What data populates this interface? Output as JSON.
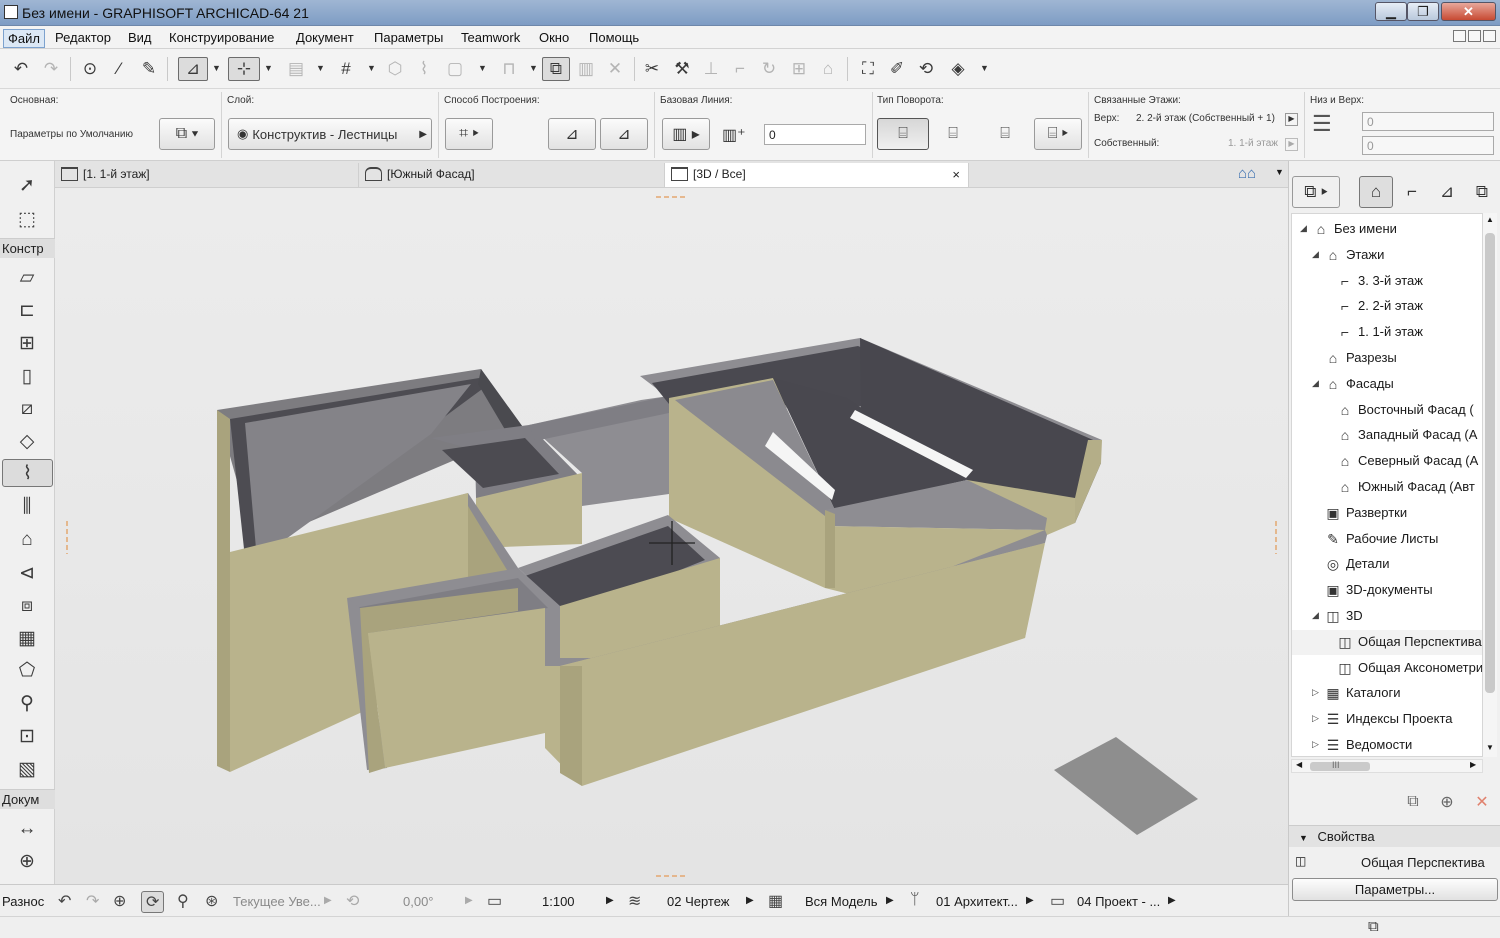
{
  "window": {
    "title": "Без имени - GRAPHISOFT ARCHICAD-64 21",
    "minimize": "▁",
    "restore": "❐",
    "close": "✕"
  },
  "menu": {
    "items": [
      "Файл",
      "Редактор",
      "Вид",
      "Конструирование",
      "Документ",
      "Параметры",
      "Teamwork",
      "Окно",
      "Помощь"
    ]
  },
  "infobox": {
    "main_label": "Основная:",
    "default_params": "Параметры по Умолчанию",
    "layer_label": "Слой:",
    "layer_value": "Конструктив - Лестницы",
    "method_label": "Способ Построения:",
    "baseline_label": "Базовая Линия:",
    "baseline_value": "0",
    "turn_label": "Тип Поворота:",
    "linked_label": "Связанные Этажи:",
    "top_label": "Верх:",
    "top_value": "2. 2-й этаж (Собственный + 1)",
    "own_label": "Собственный:",
    "own_value": "1. 1-й этаж",
    "bottom_top_label": "Низ и Верх:",
    "bottom_value": "0",
    "top_offset_value": "0"
  },
  "tabs": [
    {
      "label": "[1. 1-й этаж]"
    },
    {
      "label": "[Южный Фасад]"
    },
    {
      "label": "[3D / Все]",
      "close": "×"
    }
  ],
  "toolbox": {
    "groups": [
      "Констр",
      "Докум",
      "Разнос"
    ]
  },
  "navigator": {
    "items": [
      {
        "label": "Без имени",
        "twisty": "◢",
        "icon": "⌂"
      },
      {
        "label": "Этажи",
        "twisty": "◢",
        "icon": "⌂"
      },
      {
        "label": "3. 3-й этаж",
        "twisty": "",
        "icon": "⌐"
      },
      {
        "label": "2. 2-й этаж",
        "twisty": "",
        "icon": "⌐"
      },
      {
        "label": "1. 1-й этаж",
        "twisty": "",
        "icon": "⌐"
      },
      {
        "label": "Разрезы",
        "twisty": "",
        "icon": "⌂"
      },
      {
        "label": "Фасады",
        "twisty": "◢",
        "icon": "⌂"
      },
      {
        "label": "Восточный Фасад (",
        "twisty": "",
        "icon": "⌂"
      },
      {
        "label": "Западный Фасад (А",
        "twisty": "",
        "icon": "⌂"
      },
      {
        "label": "Северный Фасад (А",
        "twisty": "",
        "icon": "⌂"
      },
      {
        "label": "Южный Фасад (Авт",
        "twisty": "",
        "icon": "⌂"
      },
      {
        "label": "Развертки",
        "twisty": "",
        "icon": "▣"
      },
      {
        "label": "Рабочие Листы",
        "twisty": "",
        "icon": "✎"
      },
      {
        "label": "Детали",
        "twisty": "",
        "icon": "◎"
      },
      {
        "label": "3D-документы",
        "twisty": "",
        "icon": "▣"
      },
      {
        "label": "3D",
        "twisty": "◢",
        "icon": "◫"
      },
      {
        "label": "Общая Перспектива",
        "twisty": "",
        "icon": "◫"
      },
      {
        "label": "Общая Аксонометрия",
        "twisty": "",
        "icon": "◫"
      },
      {
        "label": "Каталоги",
        "twisty": "▷",
        "icon": "▦"
      },
      {
        "label": "Индексы Проекта",
        "twisty": "▷",
        "icon": "☰"
      },
      {
        "label": "Ведомости",
        "twisty": "▷",
        "icon": "☰"
      }
    ],
    "hscroll_mark": "III",
    "properties_header": "Свойства",
    "properties_value": "Общая Перспектива",
    "params_button": "Параметры..."
  },
  "statusbar": {
    "current_zoom": "Текущее Уве...",
    "angle": "0,00°",
    "scale": "1:100",
    "layer_combo": "02 Чертеж",
    "model_view": "Вся Модель",
    "pen_set": "01 Архитект...",
    "dim_standard": "04 Проект - ..."
  },
  "colors": {
    "wall_face": "#b9b38c",
    "wall_top": "#8d8c92",
    "wall_inner": "#4a4a50",
    "accent": "#7da2ce"
  }
}
